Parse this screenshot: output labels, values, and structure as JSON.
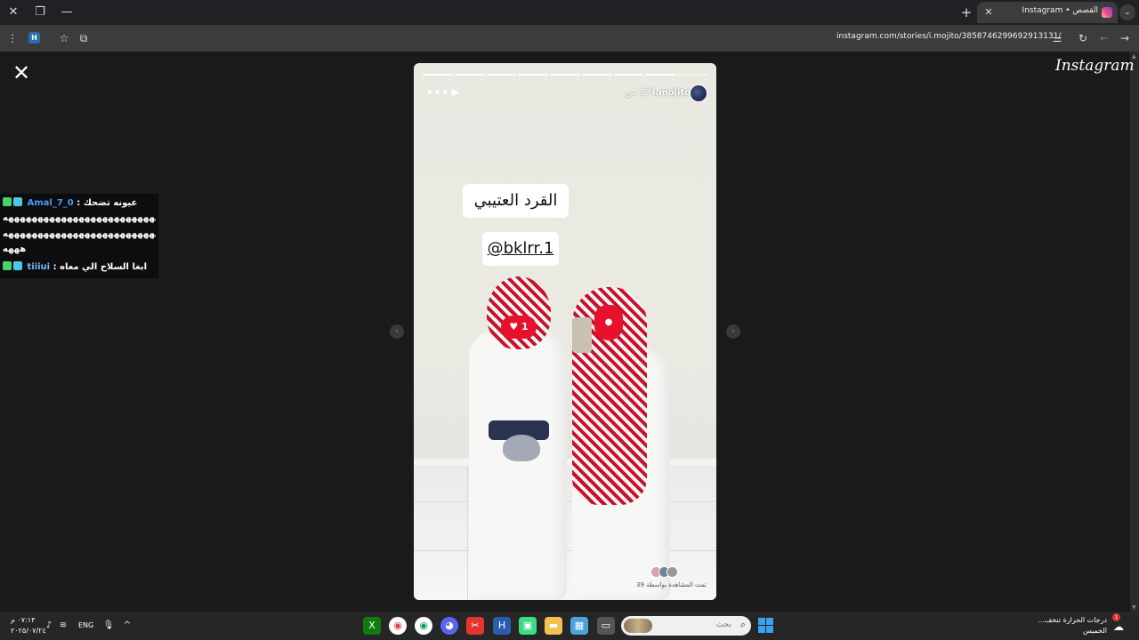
{
  "browser": {
    "tab": {
      "title": "القصص • Instagram"
    },
    "address_bar": {
      "url": "instagram.com/stories/i.mojito/3858746299692913131/"
    }
  },
  "page": {
    "close_glyph": "✕",
    "logo_text": "Instagram"
  },
  "chat": {
    "lines": [
      {
        "user": "Amal_7_0",
        "text": "عيونه تضحك :"
      },
      {
        "text": "ههههههههههههههههههههههههههههههه"
      },
      {
        "text": "هههههههههههههههههههههههههههههههه"
      },
      {
        "text": "هههه"
      },
      {
        "user": "tiiiui",
        "text": "ابغا السلاح الي معاه :"
      }
    ],
    "badge_colors": [
      "#45d66b",
      "#4ac8e8"
    ]
  },
  "story": {
    "username": "i.mojito",
    "time": "17 س",
    "sticker_text": "القرد العتيبي",
    "mention": "@bklrr.1",
    "like_count": "1",
    "viewed_by": "تمت المشاهدة بواسطة 39",
    "progress_segments": 9,
    "progress_current": 8
  },
  "taskbar": {
    "clock_time": "٠٧:١٣ م",
    "clock_date": "٢٠٢٥/٠٧/٢٤",
    "lang": "ENG",
    "search_placeholder": "بحث",
    "weather_title": "درجات الحرارة تنخف...",
    "weather_sub": "الخميس",
    "notif_count": "1"
  },
  "colors": {
    "accent_red": "#e8112d",
    "chat_user": "#4a9aff"
  }
}
